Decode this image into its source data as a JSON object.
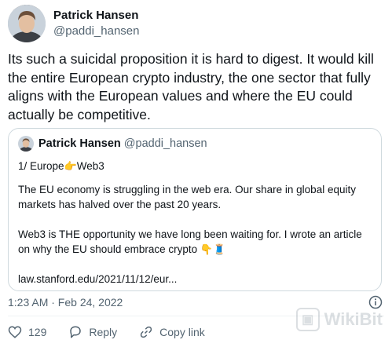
{
  "author": {
    "display_name": "Patrick Hansen",
    "handle": "@paddi_hansen"
  },
  "tweet": {
    "text": "Its such a suicidal proposition it is hard to digest. It would kill the entire European crypto industry, the one sector that fully aligns with the European values and where the EU could actually be competitive.",
    "timestamp": "1:23 AM · Feb 24, 2022"
  },
  "quoted_tweet": {
    "display_name": "Patrick Hansen",
    "handle": "@paddi_hansen",
    "line1_prefix": "1/ Europe",
    "line1_emoji": "👉",
    "line1_suffix": "Web3",
    "paragraph1": "The EU economy is struggling in the web era. Our share in global equity markets has halved over the past 20 years.",
    "paragraph2": "Web3 is THE opportunity we have long been waiting for. I wrote an article on why the EU should embrace crypto",
    "paragraph2_emoji": "👇🧵",
    "link": "law.stanford.edu/2021/11/12/eur..."
  },
  "actions": {
    "like_count": "129",
    "reply_label": "Reply",
    "copy_link_label": "Copy link"
  },
  "watermark": {
    "text": "WikiBit"
  }
}
